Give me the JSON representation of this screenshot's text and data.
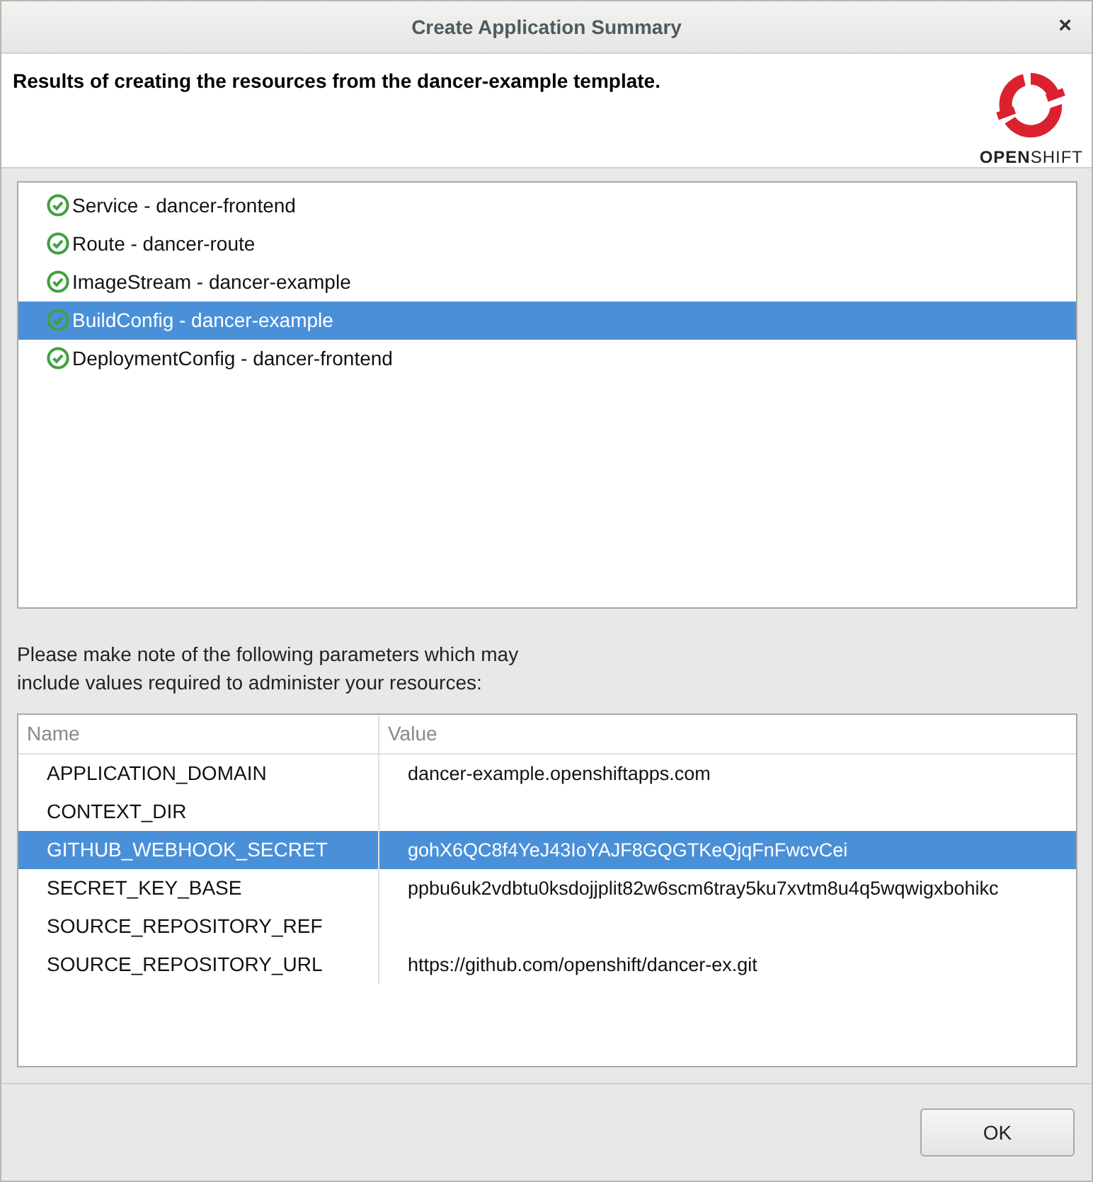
{
  "window": {
    "title": "Create Application Summary",
    "close": "×"
  },
  "header": {
    "message": "Results of creating the resources from the dancer-example template.",
    "logo_text": "**OPEN**SHIFT"
  },
  "resources": [
    {
      "label": "Service - dancer-frontend",
      "selected": false
    },
    {
      "label": "Route - dancer-route",
      "selected": false
    },
    {
      "label": "ImageStream - dancer-example",
      "selected": false
    },
    {
      "label": "BuildConfig - dancer-example",
      "selected": true
    },
    {
      "label": "DeploymentConfig - dancer-frontend",
      "selected": false
    }
  ],
  "note": "Please make note of the following parameters which may include values required to administer your resources:",
  "table": {
    "columns": [
      "Name",
      "Value"
    ],
    "rows": [
      {
        "name": "APPLICATION_DOMAIN",
        "value": "dancer-example.openshiftapps.com",
        "selected": false
      },
      {
        "name": "CONTEXT_DIR",
        "value": "",
        "selected": false
      },
      {
        "name": "GITHUB_WEBHOOK_SECRET",
        "value": "gohX6QC8f4YeJ43IoYAJF8GQGTKeQjqFnFwcvCei",
        "selected": true
      },
      {
        "name": "SECRET_KEY_BASE",
        "value": "ppbu6uk2vdbtu0ksdojjplit82w6scm6tray5ku7xvtm8u4q5wqwigxbohikc",
        "selected": false
      },
      {
        "name": "SOURCE_REPOSITORY_REF",
        "value": "",
        "selected": false
      },
      {
        "name": "SOURCE_REPOSITORY_URL",
        "value": "https://github.com/openshift/dancer-ex.git",
        "selected": false
      }
    ]
  },
  "buttons": [
    "OK"
  ]
}
